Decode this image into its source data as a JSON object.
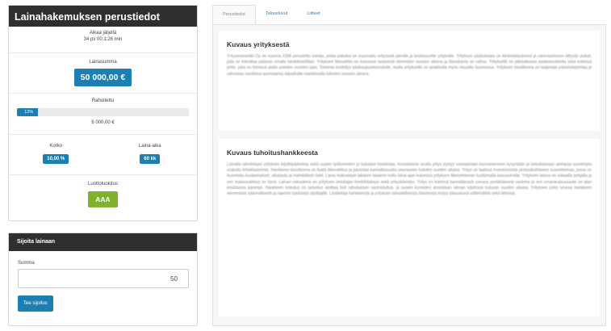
{
  "summary": {
    "title": "Lainahakemuksen perustiedot",
    "time_label": "Aikaa jäljellä",
    "time_value": "34 pv 00:1:26 min",
    "amount_label": "Lainasumma",
    "amount_value": "50 000,00 €",
    "funded_label": "Rahoitettu",
    "funded_percent": 12,
    "funded_percent_text": "12%",
    "funded_sum": "6 000,00 €",
    "rate_label": "Korko",
    "rate_value": "10,00 %",
    "term_label": "Laina-aika",
    "term_value": "60 kk",
    "rating_label": "Luottoluokitus",
    "rating_value": "AAA"
  },
  "invest": {
    "title": "Sijoita lainaan",
    "sum_label": "Summa",
    "sum_value": "50",
    "button_label": "Tee sijoitus"
  },
  "tabs": [
    {
      "label": "Perustiedot",
      "active": true
    },
    {
      "label": "Talousluvut",
      "active": false
    },
    {
      "label": "Liitteet",
      "active": false
    }
  ],
  "sections": {
    "company_title": "Kuvaus yrityksestä",
    "company_text": "Yritysesimerkki Oy on vuonna 1998 perustettu toimija, jonka palvelut on suunnattu erityisesti pienille ja keskisuurille yrityksille. Yrityksen päätoimiala on kiinteistöpalvelut ja rakentamiseen liittyvät urakat, joita se toteuttaa pääosin omalla henkilöstöllään. Yrityksen liikevaihto on kasvanut tasaisesti viimeisten vuosien aikana ja tilauskanta on vahva. Yrityksellä on pitkäaikaisia asiakassuhteita sekä kokenut johto, joka on toiminut alalla useiden vuosien ajan. Toiminta keskittyy pääkaupunkiseudulle, mutta yrityksellä on asiakkaita myös muualla Suomessa. Yrityksen tavoitteena on laajentaa palvelutarjontaa ja vahvistaa markkina-asemaansa kilpailluilla markkinoilla tulevien vuosien aikana.",
    "project_title": "Kuvaus tuhoitushankkeesta",
    "project_text": "Lainalla rahoitetaan yrityksen käyttöpääomaa sekä uusien työkoneiden ja kaluston hankintaa. Investoinnin avulla yritys pystyy vastaamaan kasvaneeseen kysyntään ja toteuttamaan aiempaa suurempia urakoita tehokkaammin. Hankkeen tavoitteena on lisätä liikevaihtoa ja parantaa kannattavuutta seuraavien kahden vuoden aikana. Yritys on laatinut investoinnista yksityiskohtaisen suunnitelman, jossa on huomioitu kustannukset, aikataulu ja mahdolliset riskit. Laina maksetaan takaisin tasaerin koko laina-ajan kuluessa yrityksen liiketoiminnan tuottamalla kassavirralla. Yrityksen talous on vakaalla pohjalla ja sen maksuvalmius on hyvä. Lainan vakuutena on yrityksen omistajan henkilötakaus sekä yrityskiinnitys. Yritys on toiminut kannattavasti useana peräkkäisenä vuotena ja sen omavaraisuusaste on alan keskitasoa parempi. Hankkeen toteutus on tarkoitus aloittaa heti rahoituksen varmistuttua, ja uusien koneiden arvioidaan olevan käytössä kuluvan vuoden aikana. Yrityksen johto seuraa hankkeen etenemistä säännöllisesti ja raportoi tuloksista sijoittajille. Lisätietoja hankkeesta ja yrityksen taloudellisesta tilanteesta löytyy talousluvut-välilehdeltä sekä liitteistä."
  }
}
